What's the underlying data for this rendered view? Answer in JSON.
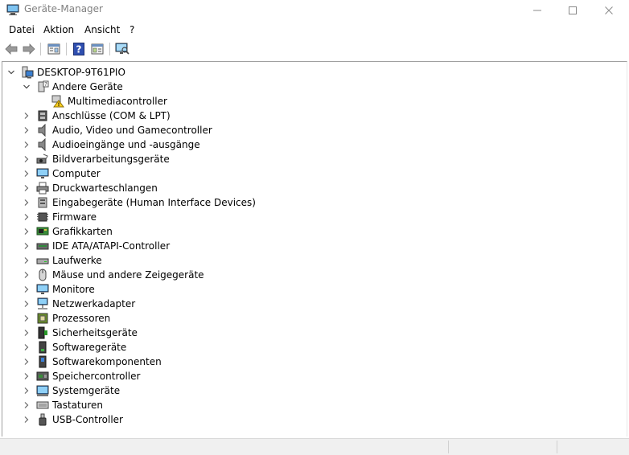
{
  "window": {
    "title": "Geräte-Manager",
    "controls": [
      "minimize-icon",
      "maximize-icon",
      "close-icon"
    ]
  },
  "menubar": {
    "items": [
      "Datei",
      "Aktion",
      "Ansicht",
      "?"
    ]
  },
  "toolbar": {
    "buttons": [
      "back-arrow-icon",
      "forward-arrow-icon",
      "properties-icon",
      "help-icon",
      "update-driver-icon",
      "scan-hardware-icon"
    ]
  },
  "tree": {
    "root": {
      "label": "DESKTOP-9T61PIO",
      "icon": "computer-icon",
      "expanded": true
    },
    "categories": [
      {
        "label": "Andere Geräte",
        "icon": "unknown-device-icon",
        "expanded": true,
        "children": [
          {
            "label": "Multimediacontroller",
            "icon": "warning-device-icon"
          }
        ]
      },
      {
        "label": "Anschlüsse (COM & LPT)",
        "icon": "port-icon"
      },
      {
        "label": "Audio, Video und Gamecontroller",
        "icon": "speaker-icon"
      },
      {
        "label": "Audioeingänge und -ausgänge",
        "icon": "speaker-icon"
      },
      {
        "label": "Bildverarbeitungsgeräte",
        "icon": "camera-icon"
      },
      {
        "label": "Computer",
        "icon": "monitor-icon"
      },
      {
        "label": "Druckwarteschlangen",
        "icon": "printer-icon"
      },
      {
        "label": "Eingabegeräte (Human Interface Devices)",
        "icon": "hid-icon"
      },
      {
        "label": "Firmware",
        "icon": "chip-icon"
      },
      {
        "label": "Grafikkarten",
        "icon": "display-adapter-icon"
      },
      {
        "label": "IDE ATA/ATAPI-Controller",
        "icon": "ide-controller-icon"
      },
      {
        "label": "Laufwerke",
        "icon": "disk-drive-icon"
      },
      {
        "label": "Mäuse und andere Zeigegeräte",
        "icon": "mouse-icon"
      },
      {
        "label": "Monitore",
        "icon": "monitor-icon"
      },
      {
        "label": "Netzwerkadapter",
        "icon": "network-icon"
      },
      {
        "label": "Prozessoren",
        "icon": "processor-icon"
      },
      {
        "label": "Sicherheitsgeräte",
        "icon": "security-device-icon"
      },
      {
        "label": "Softwaregeräte",
        "icon": "software-device-icon"
      },
      {
        "label": "Softwarekomponenten",
        "icon": "software-component-icon"
      },
      {
        "label": "Speichercontroller",
        "icon": "storage-controller-icon"
      },
      {
        "label": "Systemgeräte",
        "icon": "system-device-icon"
      },
      {
        "label": "Tastaturen",
        "icon": "keyboard-icon"
      },
      {
        "label": "USB-Controller",
        "icon": "usb-icon"
      }
    ]
  },
  "colors": {
    "title_text": "#808080",
    "selection": "#cce8ff",
    "status_bg": "#f0f0f0"
  }
}
